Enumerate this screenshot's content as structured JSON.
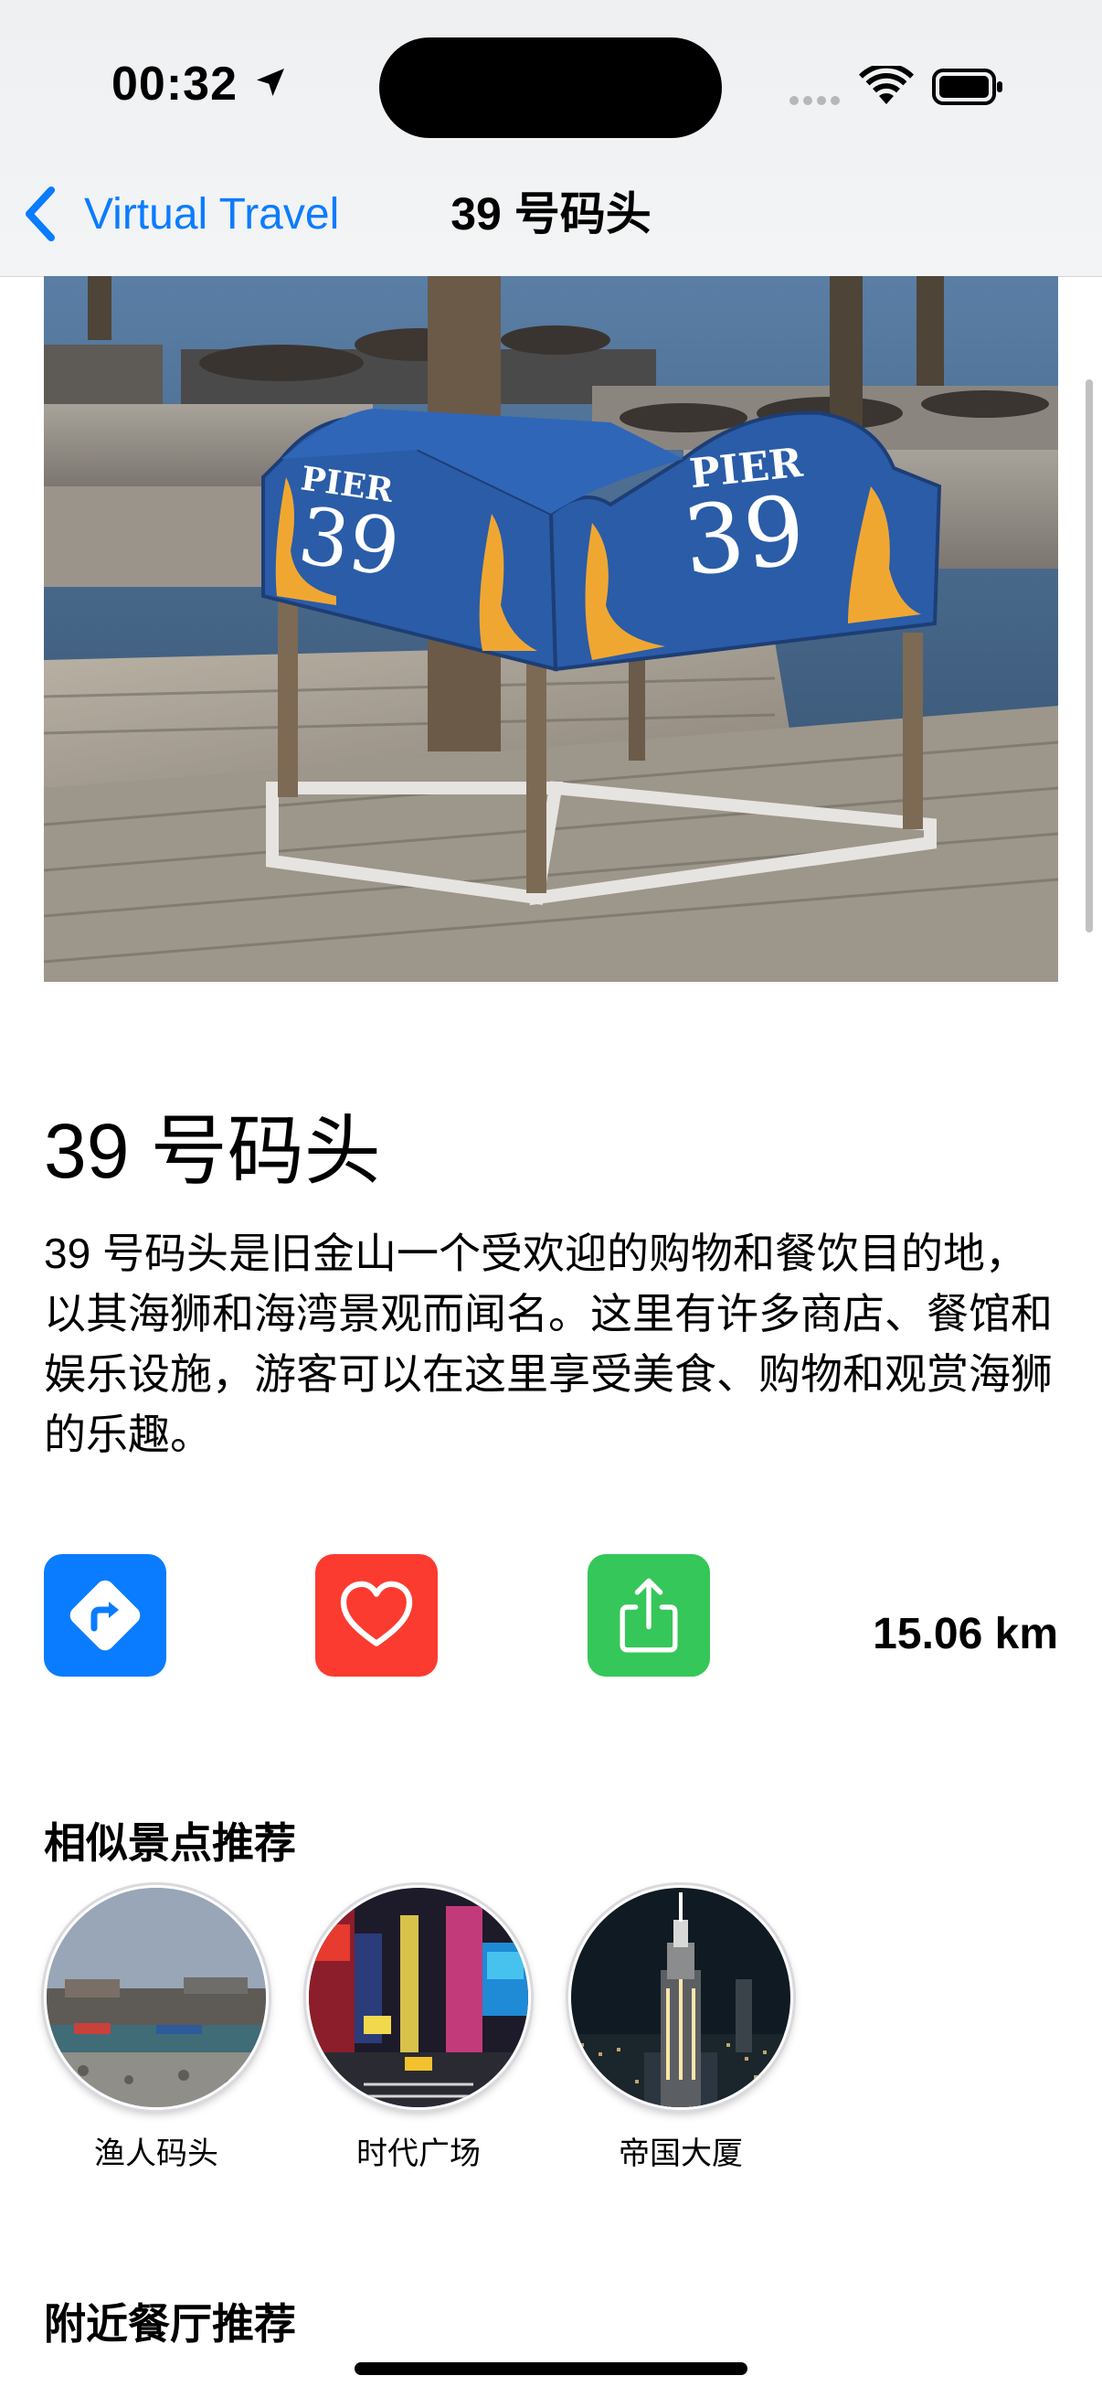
{
  "status_bar": {
    "time": "00:32"
  },
  "nav": {
    "back_label": "Virtual Travel",
    "title": "39 号码头"
  },
  "hero": {
    "sign_word": "PIER",
    "sign_number": "39"
  },
  "place": {
    "title": "39 号码头",
    "description": "39 号码头是旧金山一个受欢迎的购物和餐饮目的地，以其海狮和海湾景观而闻名。这里有许多商店、餐馆和娱乐设施，游客可以在这里享受美食、购物和观赏海狮的乐趣。",
    "distance": "15.06 km"
  },
  "actions": {
    "directions_color": "#0A7CFF",
    "favorite_color": "#FB3B30",
    "share_color": "#35C759"
  },
  "similar": {
    "title": "相似景点推荐",
    "items": [
      {
        "label": "渔人码头"
      },
      {
        "label": "时代广场"
      },
      {
        "label": "帝国大厦"
      }
    ]
  },
  "nearby": {
    "title": "附近餐厅推荐"
  }
}
